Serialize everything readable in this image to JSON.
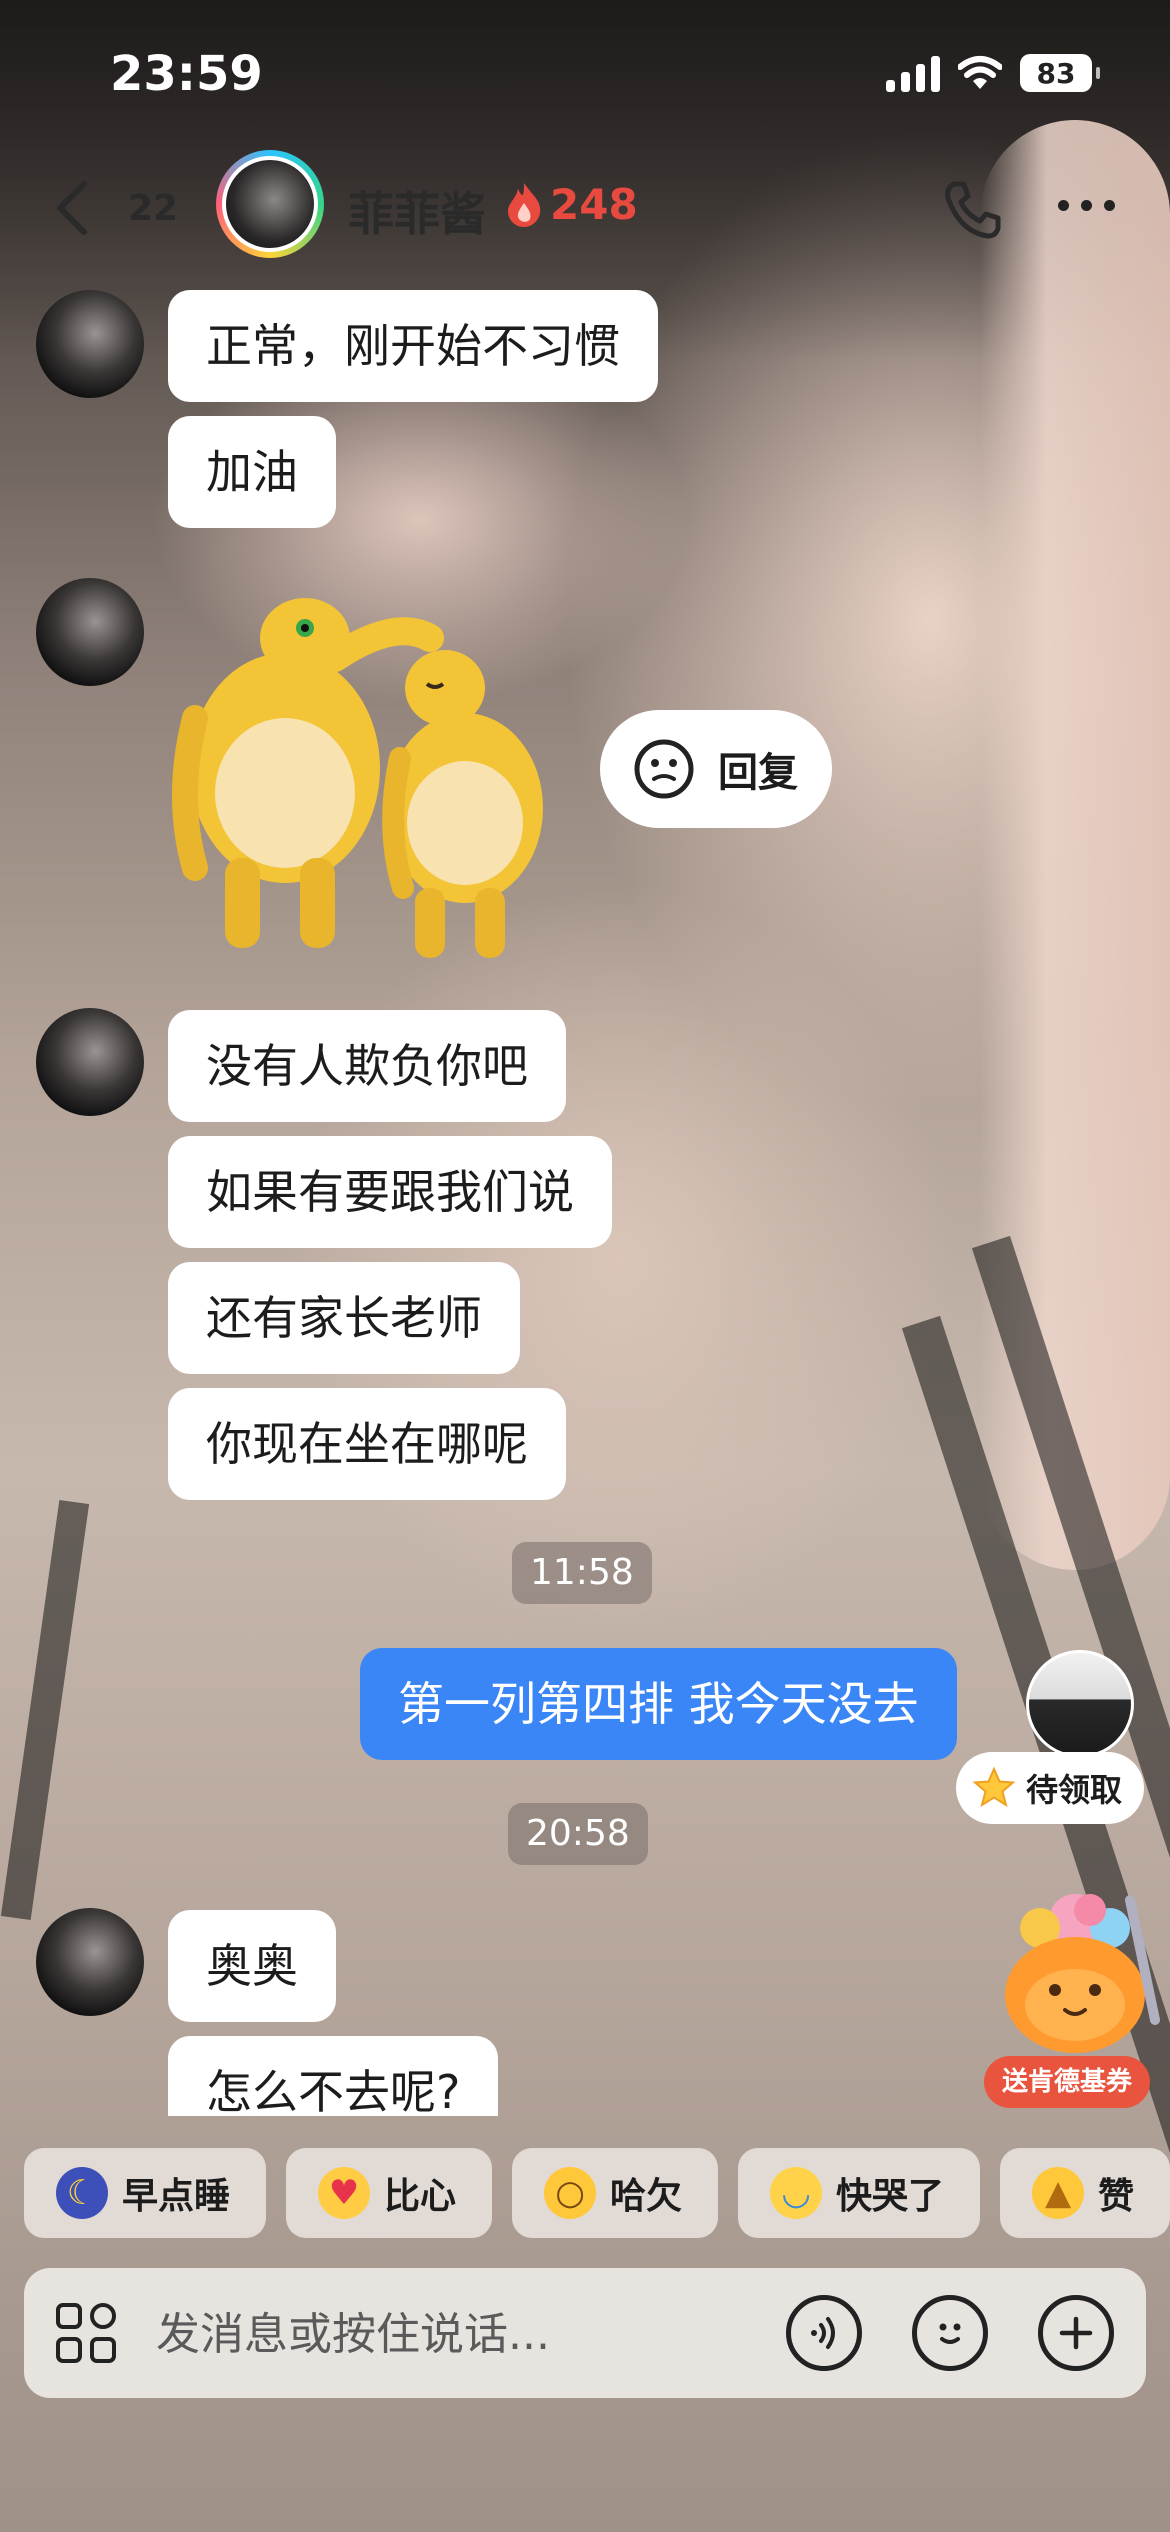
{
  "status_bar": {
    "time": "23:59",
    "battery": "83"
  },
  "header": {
    "unread_count": "22",
    "contact_name": "菲菲酱",
    "spark_count": "248"
  },
  "messages": [
    {
      "text": "正常，刚开始不习惯"
    },
    {
      "text": "加油"
    },
    {
      "text": "没有人欺负你吧"
    },
    {
      "text": "如果有要跟我们说"
    },
    {
      "text": "还有家长老师"
    },
    {
      "text": "你现在坐在哪呢"
    },
    {
      "text": "第一列第四排 我今天没去"
    },
    {
      "text": "奥奥"
    },
    {
      "text": "怎么不去呢?"
    }
  ],
  "timestamps": [
    "11:58",
    "20:58"
  ],
  "reply_chip": {
    "label": "回复"
  },
  "reward_chip": {
    "label": "待领取"
  },
  "kfc_widget": {
    "label": "送肯德基券"
  },
  "quick_replies": [
    {
      "label": "早点睡",
      "icon": "moon-sleep-icon"
    },
    {
      "label": "比心",
      "icon": "heart-hand-icon"
    },
    {
      "label": "哈欠",
      "icon": "yawn-face-icon"
    },
    {
      "label": "快哭了",
      "icon": "teary-face-icon"
    },
    {
      "label": "赞",
      "icon": "thumbs-up-icon"
    }
  ],
  "input": {
    "placeholder": "发消息或按住说话..."
  },
  "colors": {
    "self_bubble": "#3b86f6",
    "spark": "#e84a3f",
    "kfc_badge": "#e8543d"
  }
}
